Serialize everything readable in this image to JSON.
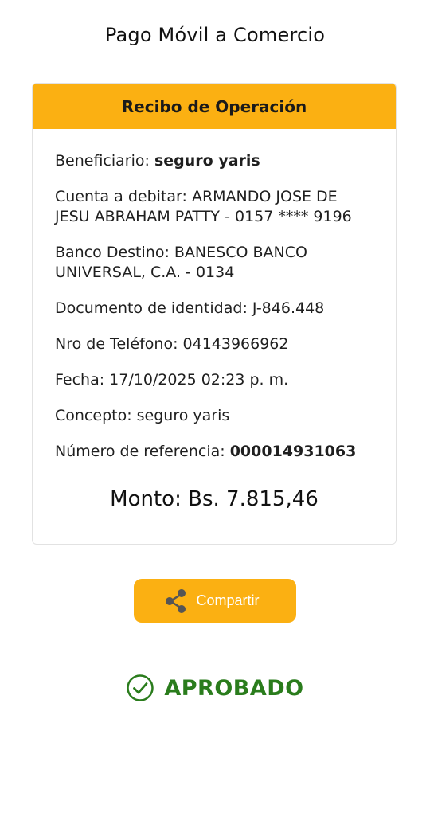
{
  "header": {
    "title": "Pago Móvil a Comercio"
  },
  "receipt": {
    "title": "Recibo de Operación",
    "beneficiary_label": "Beneficiario: ",
    "beneficiary_value": "seguro yaris",
    "debit_account": "Cuenta a debitar: ARMANDO JOSE DE JESU ABRAHAM PATTY - 0157 **** 9196",
    "destination_bank": "Banco Destino: BANESCO BANCO UNIVERSAL, C.A. - 0134",
    "id_document": "Documento de identidad: J-846.448",
    "phone": "Nro de Teléfono: 04143966962",
    "date": "Fecha: 17/10/2025 02:23 p. m.",
    "concept": "Concepto: seguro yaris",
    "reference_label": "Número de referencia: ",
    "reference_value": "000014931063",
    "amount": "Monto: Bs. 7.815,46"
  },
  "actions": {
    "share_label": "Compartir",
    "share_icon": "share-icon"
  },
  "status": {
    "label": "APROBADO",
    "icon": "check-circle-icon",
    "color": "#2a7c1c"
  },
  "colors": {
    "accent": "#fbb012"
  }
}
